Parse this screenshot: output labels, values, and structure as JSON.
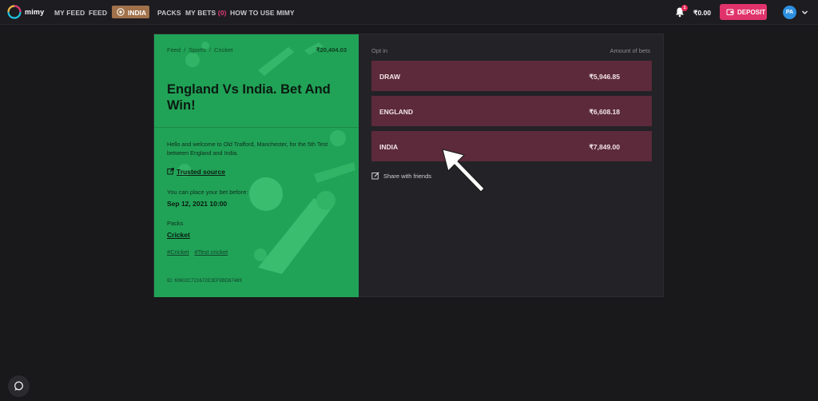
{
  "header": {
    "logo_text": "mimy",
    "nav": {
      "my_feed": "MY FEED",
      "feed": "FEED",
      "india": "INDIA",
      "packs": "PACKS",
      "my_bets": "MY BETS",
      "my_bets_count": "(0)",
      "how_to": "HOW TO USE MIMY"
    },
    "notifications_count": "1",
    "balance": "₹0.00",
    "deposit_label": "DEPOSIT",
    "avatar_initials": "PA"
  },
  "event": {
    "breadcrumb": [
      "Feed",
      "Sports",
      "Cricket"
    ],
    "breadcrumb_sep": "/",
    "pool": "₹20,404.03",
    "title": "England Vs India. Bet And Win!",
    "description": "Hello and welcome to Old Trafford, Manchester, for the 5th Test between England and India.",
    "trusted_source": "Trusted source",
    "place_bet_label": "You can place your bet before:",
    "deadline": "Sep 12, 2021 10:00",
    "packs_label": "Packs",
    "packs_value": "Cricket",
    "tags": [
      "#Cricket",
      "#Test cricket"
    ],
    "id_text": "ID: 60602C721672E3EF8BD87489"
  },
  "options_panel": {
    "opt_in_label": "Opt in",
    "amount_label": "Amount of bets",
    "options": [
      {
        "name": "DRAW",
        "amount": "₹5,946.85"
      },
      {
        "name": "ENGLAND",
        "amount": "₹6,608.18"
      },
      {
        "name": "INDIA",
        "amount": "₹7,849.00"
      }
    ],
    "share_label": "Share with friends"
  },
  "colors": {
    "page_bg": "#19181b",
    "card_green": "#21a357",
    "option_bg": "#5c2a3a",
    "deposit_pink": "#e0336b",
    "nav_active": "#a0714a",
    "avatar_blue": "#2d8fe0"
  },
  "icons": [
    "mimy-logo-icon",
    "india-flag-icon",
    "bell-icon",
    "wallet-icon",
    "chevron-down-icon",
    "external-link-icon",
    "share-edit-icon",
    "pointer-arrow-icon",
    "chat-bubble-icon"
  ]
}
